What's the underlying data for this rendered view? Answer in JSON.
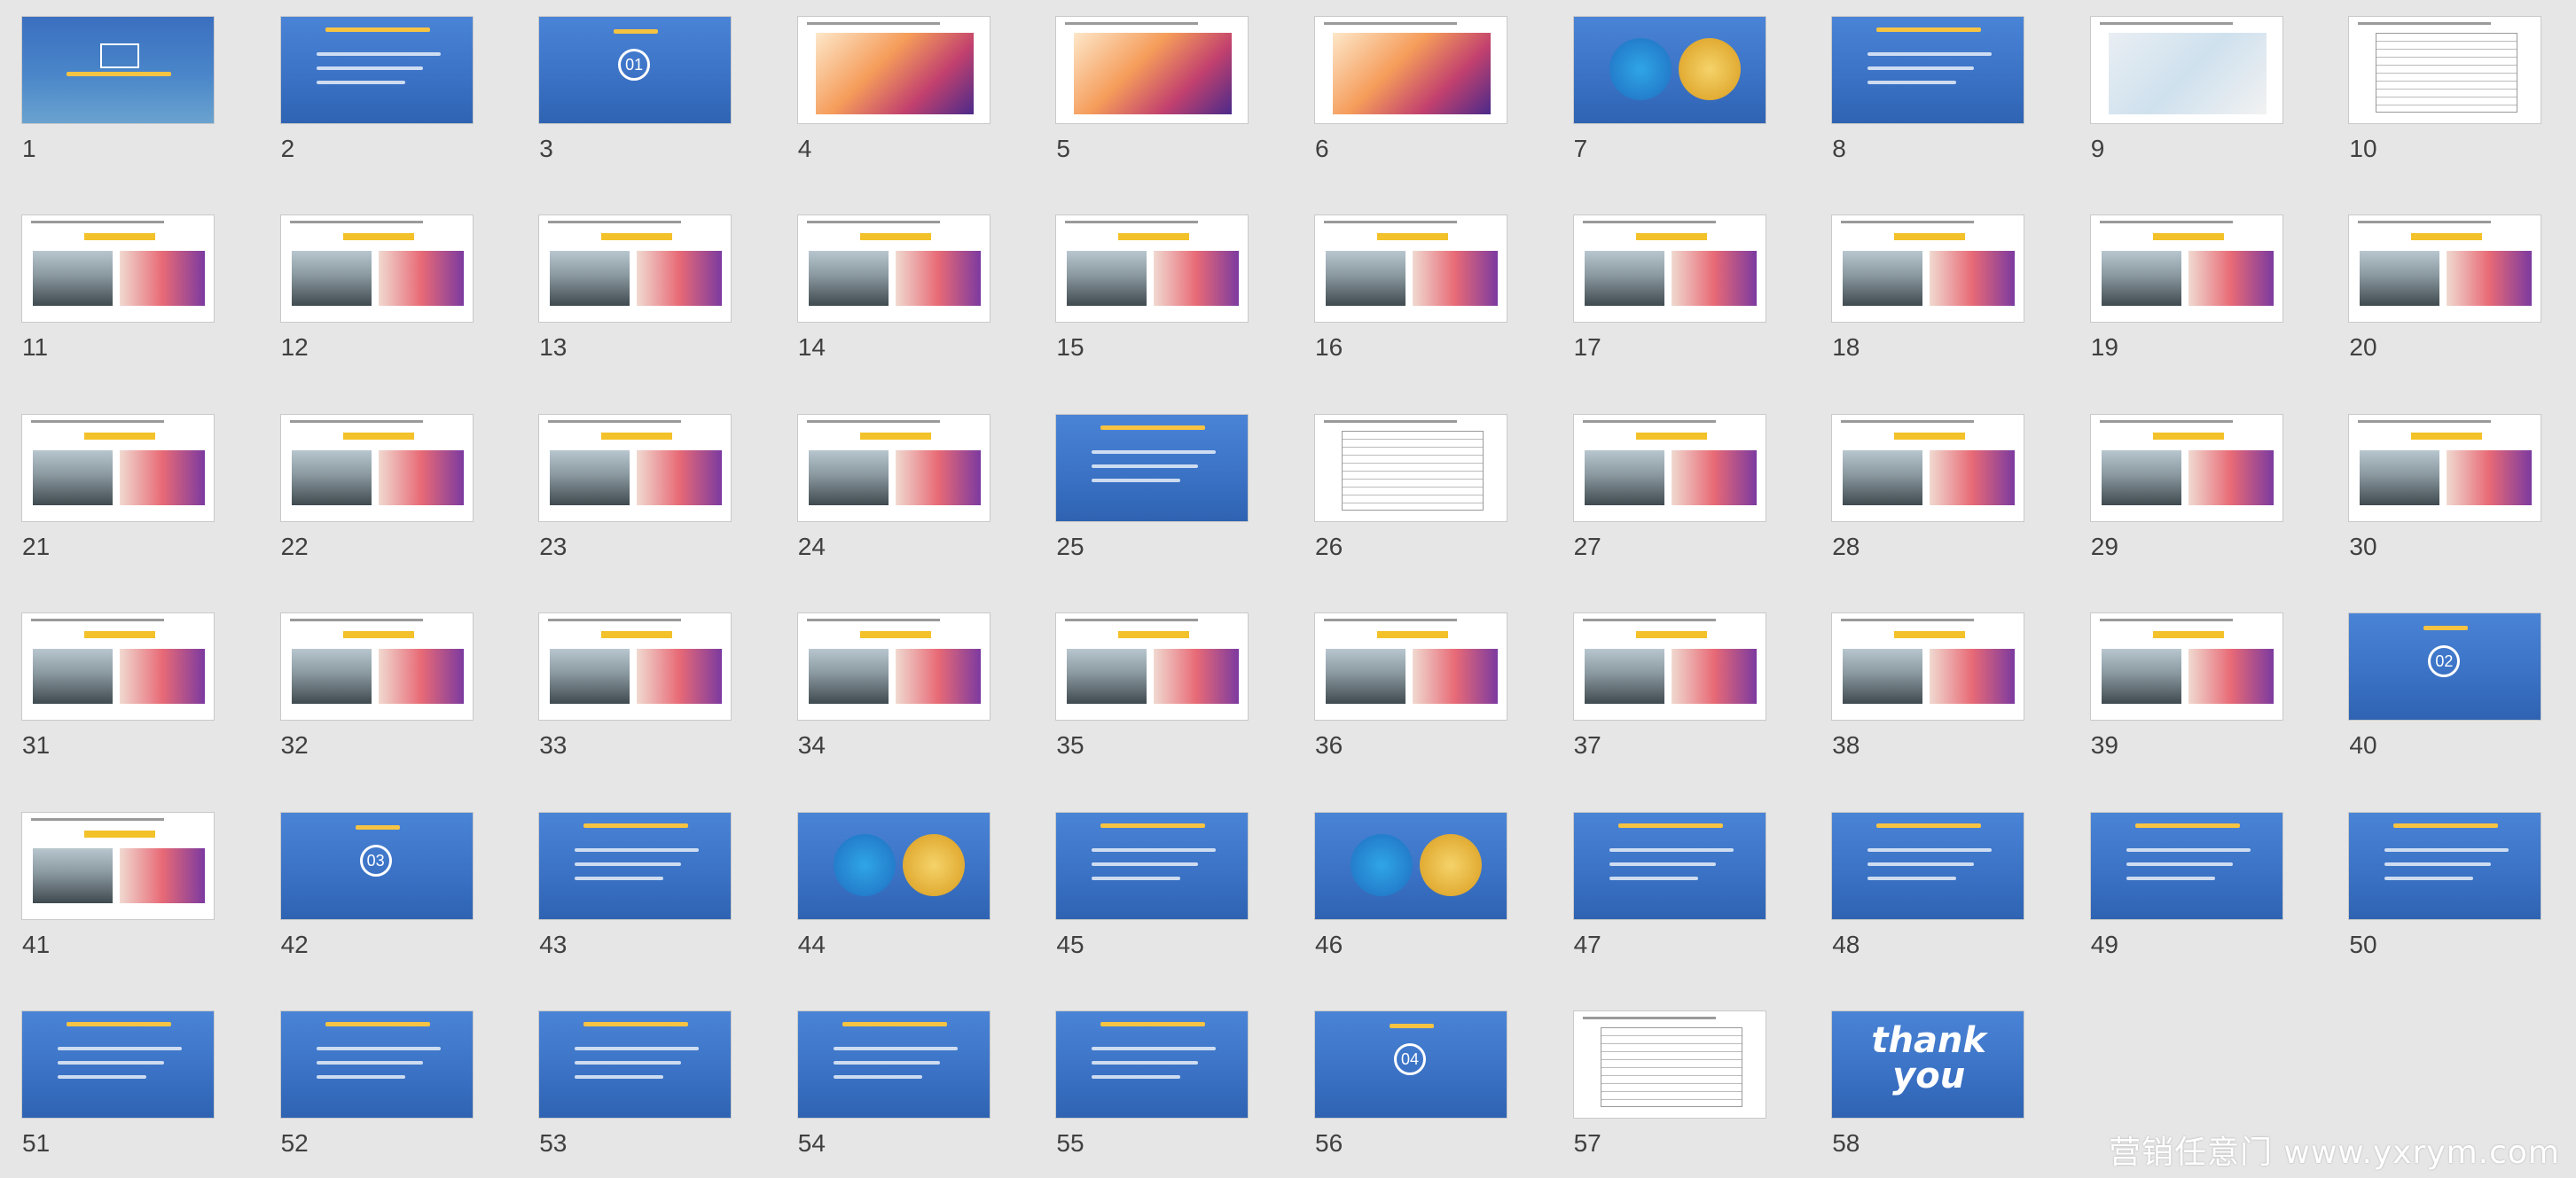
{
  "app": {
    "view": "slide-sorter",
    "slide_count": 58
  },
  "slides": [
    {
      "number": "1",
      "style": "cover",
      "kind": "cover"
    },
    {
      "number": "2",
      "style": "blue",
      "kind": "agenda"
    },
    {
      "number": "3",
      "style": "blue",
      "kind": "section",
      "section": "01"
    },
    {
      "number": "4",
      "style": "white",
      "kind": "poster"
    },
    {
      "number": "5",
      "style": "white",
      "kind": "poster"
    },
    {
      "number": "6",
      "style": "white",
      "kind": "poster"
    },
    {
      "number": "7",
      "style": "blue",
      "kind": "circles"
    },
    {
      "number": "8",
      "style": "blue",
      "kind": "title"
    },
    {
      "number": "9",
      "style": "white",
      "kind": "map"
    },
    {
      "number": "10",
      "style": "white",
      "kind": "table"
    },
    {
      "number": "11",
      "style": "white",
      "kind": "photo"
    },
    {
      "number": "12",
      "style": "white",
      "kind": "photo"
    },
    {
      "number": "13",
      "style": "white",
      "kind": "photo"
    },
    {
      "number": "14",
      "style": "white",
      "kind": "photo"
    },
    {
      "number": "15",
      "style": "white",
      "kind": "photo"
    },
    {
      "number": "16",
      "style": "white",
      "kind": "photo"
    },
    {
      "number": "17",
      "style": "white",
      "kind": "photo"
    },
    {
      "number": "18",
      "style": "white",
      "kind": "photo"
    },
    {
      "number": "19",
      "style": "white",
      "kind": "photo"
    },
    {
      "number": "20",
      "style": "white",
      "kind": "photo"
    },
    {
      "number": "21",
      "style": "white",
      "kind": "photo"
    },
    {
      "number": "22",
      "style": "white",
      "kind": "photo"
    },
    {
      "number": "23",
      "style": "white",
      "kind": "photo"
    },
    {
      "number": "24",
      "style": "white",
      "kind": "photo"
    },
    {
      "number": "25",
      "style": "blue",
      "kind": "title"
    },
    {
      "number": "26",
      "style": "white",
      "kind": "table"
    },
    {
      "number": "27",
      "style": "white",
      "kind": "photo"
    },
    {
      "number": "28",
      "style": "white",
      "kind": "photo"
    },
    {
      "number": "29",
      "style": "white",
      "kind": "photo"
    },
    {
      "number": "30",
      "style": "white",
      "kind": "photo"
    },
    {
      "number": "31",
      "style": "white",
      "kind": "photo"
    },
    {
      "number": "32",
      "style": "white",
      "kind": "photo"
    },
    {
      "number": "33",
      "style": "white",
      "kind": "photo"
    },
    {
      "number": "34",
      "style": "white",
      "kind": "photo"
    },
    {
      "number": "35",
      "style": "white",
      "kind": "photo"
    },
    {
      "number": "36",
      "style": "white",
      "kind": "photo"
    },
    {
      "number": "37",
      "style": "white",
      "kind": "photo"
    },
    {
      "number": "38",
      "style": "white",
      "kind": "photo"
    },
    {
      "number": "39",
      "style": "white",
      "kind": "photo"
    },
    {
      "number": "40",
      "style": "blue",
      "kind": "section",
      "section": "02"
    },
    {
      "number": "41",
      "style": "white",
      "kind": "photo"
    },
    {
      "number": "42",
      "style": "blue",
      "kind": "section",
      "section": "03"
    },
    {
      "number": "43",
      "style": "blue",
      "kind": "steps"
    },
    {
      "number": "44",
      "style": "blue",
      "kind": "circles"
    },
    {
      "number": "45",
      "style": "blue",
      "kind": "text"
    },
    {
      "number": "46",
      "style": "blue",
      "kind": "circles"
    },
    {
      "number": "47",
      "style": "blue",
      "kind": "text"
    },
    {
      "number": "48",
      "style": "blue",
      "kind": "steps"
    },
    {
      "number": "49",
      "style": "blue",
      "kind": "text"
    },
    {
      "number": "50",
      "style": "blue",
      "kind": "steps"
    },
    {
      "number": "51",
      "style": "blue",
      "kind": "text"
    },
    {
      "number": "52",
      "style": "blue",
      "kind": "text"
    },
    {
      "number": "53",
      "style": "blue",
      "kind": "text"
    },
    {
      "number": "54",
      "style": "blue",
      "kind": "text"
    },
    {
      "number": "55",
      "style": "blue",
      "kind": "text"
    },
    {
      "number": "56",
      "style": "blue",
      "kind": "section",
      "section": "04"
    },
    {
      "number": "57",
      "style": "white",
      "kind": "table"
    },
    {
      "number": "58",
      "style": "blue",
      "kind": "thanks"
    }
  ],
  "thanks_slide": {
    "line1": "thank",
    "line2": "you"
  },
  "watermark": {
    "text": "营销任意门 www.yxrym.com"
  },
  "colors": {
    "background": "#e6e6e6",
    "slide_blue": "#3a71c4",
    "accent_yellow": "#f3c129",
    "number_text": "#404040"
  }
}
